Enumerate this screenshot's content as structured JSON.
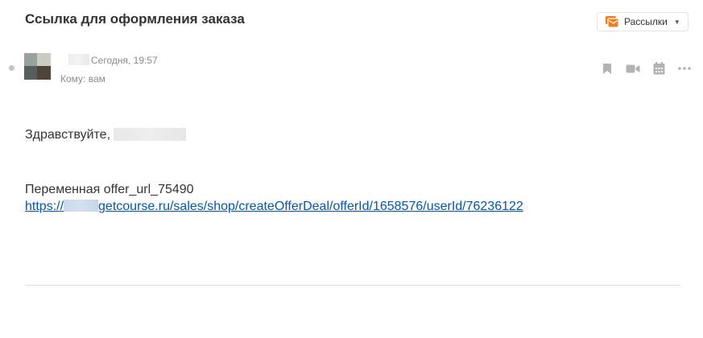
{
  "message": {
    "subject": "Ссылка для оформления заказа",
    "folder_button": {
      "label": "Рассылки",
      "icon": "newsletter-folder-icon"
    },
    "sender": {
      "date": "Сегодня, 19:57",
      "to": "Кому: вам"
    },
    "actions": [
      {
        "name": "bookmark-icon"
      },
      {
        "name": "video-call-icon"
      },
      {
        "name": "calendar-icon"
      },
      {
        "name": "more-icon"
      }
    ],
    "body": {
      "greeting": "Здравствуйте,",
      "variable_line": "Переменная offer_url_75490",
      "link_prefix": "https://",
      "link_suffix": "getcourse.ru/sales/shop/createOfferDeal/offerId/1658576/userId/76236122"
    }
  },
  "colors": {
    "text": "#333333",
    "meta": "#8a8a8a",
    "link": "#0055bb",
    "accent_orange": "#f37c1f",
    "icon_gray": "#b3b3b3"
  }
}
